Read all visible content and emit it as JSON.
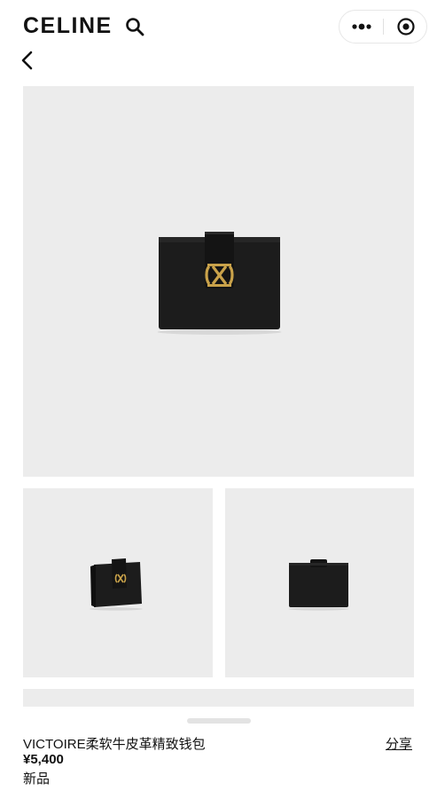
{
  "header": {
    "brand": "CELINE",
    "icons": {
      "search": "search-icon",
      "more": "more-dots-icon",
      "close": "target-circle-icon",
      "back": "chevron-left-icon"
    }
  },
  "gallery": {
    "images": [
      {
        "name": "main-product-image",
        "view": "front"
      },
      {
        "name": "thumbnail-side",
        "view": "side"
      },
      {
        "name": "thumbnail-back",
        "view": "back"
      },
      {
        "name": "thumbnail-partial",
        "view": "partial"
      }
    ]
  },
  "product": {
    "title": "VICTOIRE柔软牛皮革精致钱包",
    "price": "¥5,400",
    "badge": "新品",
    "share_label": "分享"
  },
  "colors": {
    "background": "#ffffff",
    "image_bg": "#ececec",
    "leather": "#1c1c1c",
    "gold": "#c9a24a",
    "text": "#111111"
  }
}
